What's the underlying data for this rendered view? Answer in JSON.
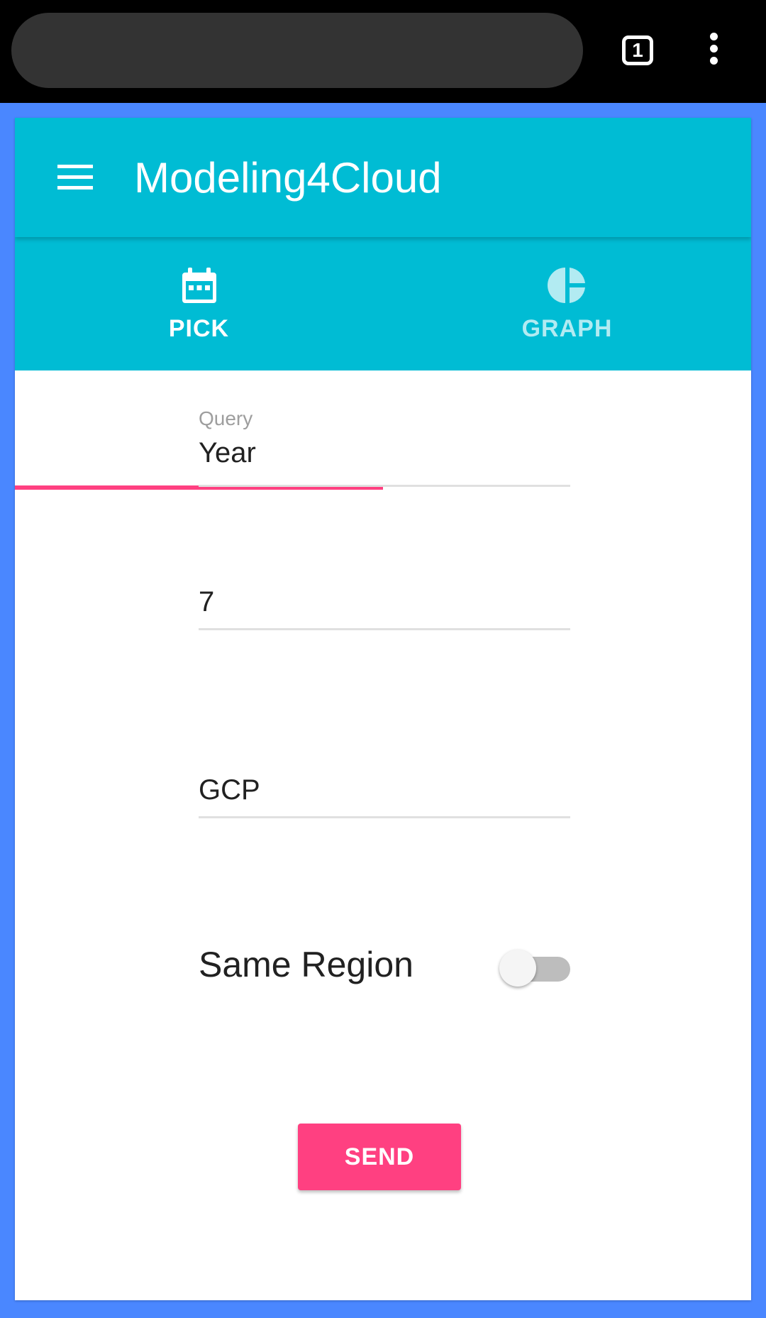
{
  "browser": {
    "tab_count": "1",
    "icons": {
      "tabs": "tab-switcher-icon",
      "menu": "more-vert-icon"
    }
  },
  "app": {
    "title": "Modeling4Cloud",
    "menu_icon": "hamburger-menu-icon",
    "colors": {
      "primary": "#00bcd4",
      "accent": "#ff4081",
      "page_bg": "#4a87ff"
    }
  },
  "tabs": [
    {
      "label": "PICK",
      "icon": "calendar-icon",
      "selected": true
    },
    {
      "label": "GRAPH",
      "icon": "pie-chart-icon",
      "selected": false
    }
  ],
  "form": {
    "query": {
      "label": "Query",
      "value": "Year"
    },
    "number": {
      "value": "7"
    },
    "provider": {
      "value": "GCP"
    },
    "same_region": {
      "label": "Same Region",
      "checked": false
    },
    "send_label": "SEND"
  }
}
